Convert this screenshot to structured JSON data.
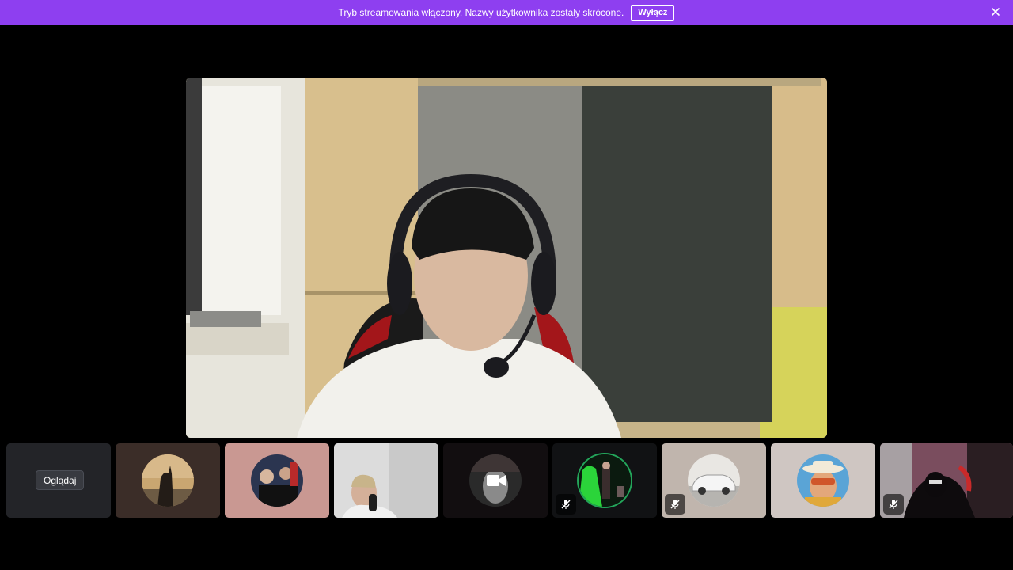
{
  "banner": {
    "message": "Tryb streamowania włączony. Nazwy użytkownika zostały skrócone.",
    "disable_label": "Wyłącz",
    "background": "#8e3ff0"
  },
  "strip": {
    "watch_label": "Oglądaj",
    "tiles": [
      {
        "kind": "watch",
        "icon": "none"
      },
      {
        "kind": "avatar",
        "icon": "sunset-silhouette-avatar"
      },
      {
        "kind": "avatar",
        "icon": "crowd-photo-avatar"
      },
      {
        "kind": "video",
        "icon": "person-with-microphone-video"
      },
      {
        "kind": "camera-off",
        "icon": "video-camera-icon"
      },
      {
        "kind": "avatar",
        "icon": "green-light-avatar",
        "speaking": true,
        "muted": true
      },
      {
        "kind": "avatar",
        "icon": "white-car-avatar",
        "muted": true
      },
      {
        "kind": "avatar",
        "icon": "sunglasses-hat-avatar"
      },
      {
        "kind": "video",
        "icon": "hooded-figure-video",
        "muted": true
      }
    ]
  },
  "colors": {
    "speaking_ring": "#23a55a",
    "tile_dark": "#232428"
  }
}
